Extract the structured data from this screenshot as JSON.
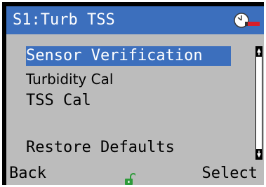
{
  "header": {
    "title": "S1:Turb TSS",
    "status_icon": "clock-probe-icon"
  },
  "menu": {
    "items": [
      {
        "label": "Sensor Verification",
        "selected": true
      },
      {
        "label": "Turbidity Cal",
        "selected": false
      },
      {
        "label": "TSS Cal",
        "selected": false
      },
      {
        "label": "Restore Defaults",
        "selected": false
      }
    ]
  },
  "footer": {
    "back_label": "Back",
    "select_label": "Select",
    "lock_icon": "unlocked-padlock-icon"
  },
  "colors": {
    "accent": "#3c6fbd",
    "screen_background": "#bcbcbc",
    "lock_green": "#2e9a3a"
  }
}
